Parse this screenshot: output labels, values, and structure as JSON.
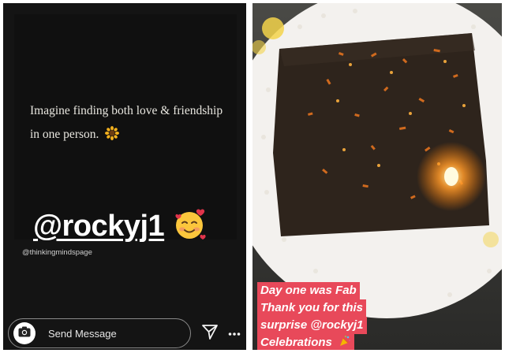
{
  "left_story": {
    "quote": {
      "line1": "Imagine finding both love & friendship",
      "line2": "in one person.",
      "emoji": "sunflower-icon"
    },
    "mention": "@rockyj1",
    "mention_emoji": "smiling-face-with-hearts-icon",
    "handle": "@thinkingmindspage",
    "reply_bar": {
      "placeholder": "Send Message",
      "camera_icon": "camera-icon",
      "send_icon": "paper-plane-icon",
      "more_icon": "more-vertical-icon"
    }
  },
  "right_story": {
    "caption_lines": [
      "Day one was Fab",
      "Thank you for this",
      "surprise @rockyj1",
      "Celebrations"
    ],
    "caption_emoji": "party-popper-icon",
    "colors": {
      "caption_bg": "#e8495a",
      "plate": "#f3f1ee",
      "cake": "#2e241c"
    }
  }
}
